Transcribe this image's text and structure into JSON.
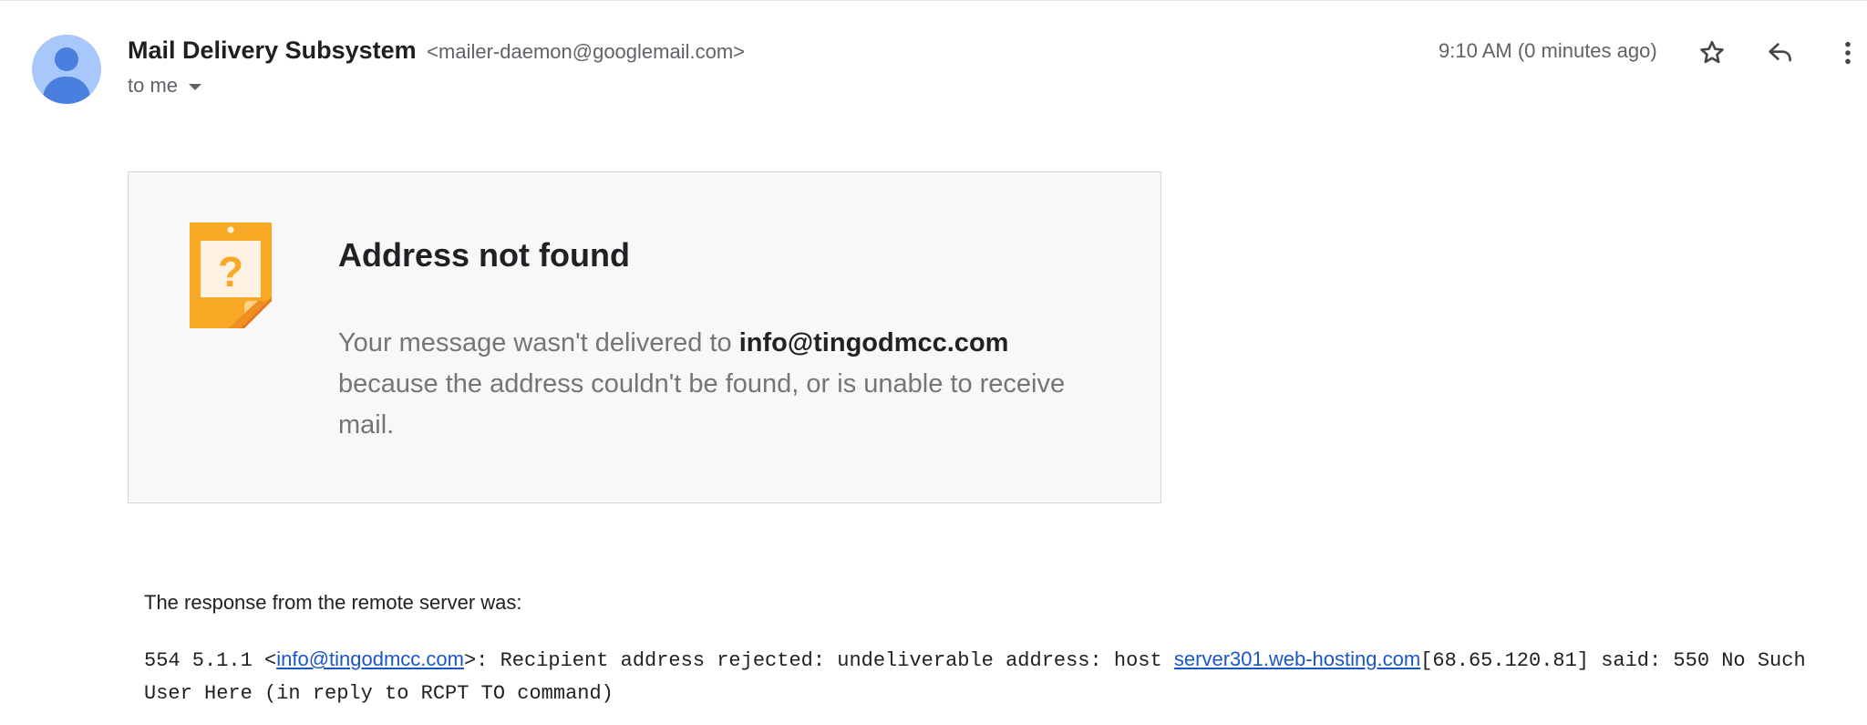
{
  "header": {
    "sender_name": "Mail Delivery Subsystem",
    "sender_email": "<mailer-daemon@googlemail.com>",
    "recipient": "to me",
    "timestamp": "9:10 AM (0 minutes ago)",
    "icons": [
      "avatar",
      "chevron-down-icon",
      "star-icon",
      "reply-icon",
      "more-vert-icon"
    ]
  },
  "card": {
    "icon": "question-note-icon",
    "title": "Address not found",
    "message_prefix": "Your message wasn't delivered to ",
    "address": "info@tingodmcc.com",
    "message_suffix": " because the address couldn't be found, or is unable to receive mail."
  },
  "response": {
    "label": "The response from the remote server was:",
    "part1": "554 5.1.1 <",
    "link1": "info@tingodmcc.com",
    "part2": ">: Recipient address rejected: undeliverable address: host ",
    "link2": "server301.web-hosting.com",
    "part3": "[68.65.120.81] said: 550 No Such User Here (in reply to RCPT TO command)"
  },
  "colors": {
    "accent_link": "#1a57c5",
    "avatar_bg": "#a8c7fa",
    "avatar_fg": "#4a7fe0",
    "note_orange": "#f9a825"
  }
}
